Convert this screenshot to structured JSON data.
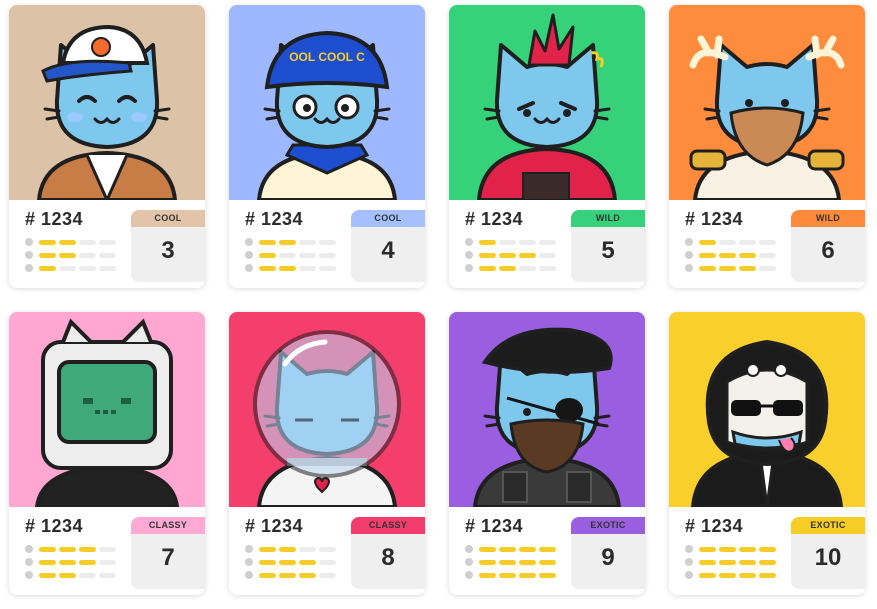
{
  "colors": {
    "bar_on": "#f6cd27",
    "bar_off": "#ececec",
    "cat_body": "#7ec8ee",
    "outline": "#1f1f1f"
  },
  "cards": [
    {
      "id": "# 1234",
      "tier": "COOL",
      "tier_color": "#e2c5a9",
      "score": "3",
      "bg": "#dcc3a8",
      "stats": [
        2,
        2,
        1
      ],
      "character": "cat-orange-dot-cap-brown-jacket"
    },
    {
      "id": "# 1234",
      "tier": "COOL",
      "tier_color": "#a5bfff",
      "score": "4",
      "bg": "#9db8ff",
      "stats": [
        2,
        1,
        2
      ],
      "character": "cat-blue-bucket-hat-polo",
      "hat_text": "OOL COOL C"
    },
    {
      "id": "# 1234",
      "tier": "WILD",
      "tier_color": "#37d17b",
      "score": "5",
      "bg": "#36d27a",
      "stats": [
        1,
        3,
        2
      ],
      "character": "cat-red-mohawk-red-hoodie"
    },
    {
      "id": "# 1234",
      "tier": "WILD",
      "tier_color": "#ff8a3c",
      "score": "6",
      "bg": "#ff8c3d",
      "stats": [
        1,
        3,
        3
      ],
      "character": "cat-antlers-beard-military-jacket"
    },
    {
      "id": "# 1234",
      "tier": "CLASSY",
      "tier_color": "#ffa9d4",
      "score": "7",
      "bg": "#ffa7d1",
      "stats": [
        3,
        3,
        2
      ],
      "character": "cat-tv-head-black-coat"
    },
    {
      "id": "# 1234",
      "tier": "CLASSY",
      "tier_color": "#f23d6c",
      "score": "8",
      "bg": "#f43f6d",
      "stats": [
        2,
        3,
        3
      ],
      "character": "cat-astronaut-helmet-white-sweater"
    },
    {
      "id": "# 1234",
      "tier": "EXOTIC",
      "tier_color": "#9a5fe0",
      "score": "9",
      "bg": "#9a5fe0",
      "stats": [
        4,
        4,
        4
      ],
      "character": "cat-beret-eyepatch-beard-tactical-vest"
    },
    {
      "id": "# 1234",
      "tier": "EXOTIC",
      "tier_color": "#f6cd27",
      "score": "10",
      "bg": "#f9cf2b",
      "stats": [
        4,
        4,
        4
      ],
      "character": "cat-gorilla-costume-sunglasses"
    }
  ]
}
